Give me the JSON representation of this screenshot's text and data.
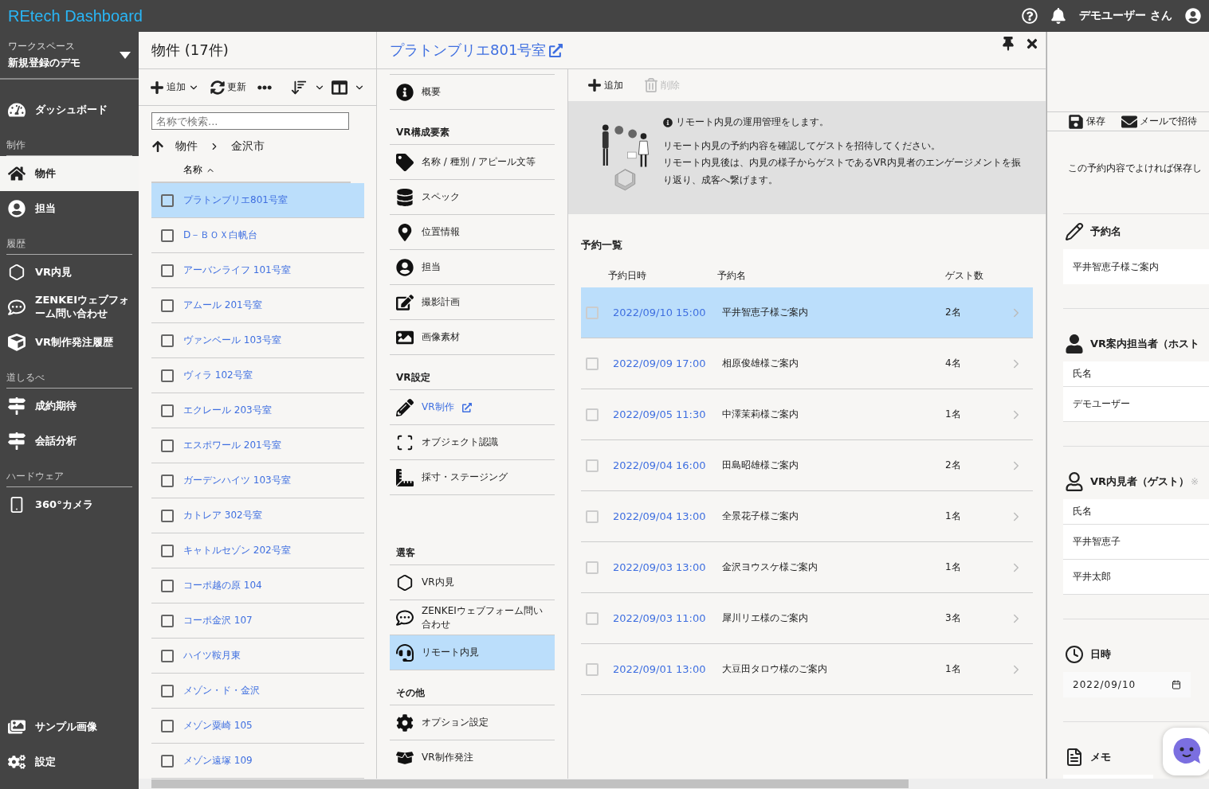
{
  "header": {
    "title": "REtech Dashboard",
    "user": "デモユーザー さん"
  },
  "sidebar": {
    "workspace_label": "ワークスペース",
    "workspace_name": "新規登録のデモ",
    "top_items": [
      {
        "label": "ダッシュボード",
        "selected": false
      }
    ],
    "sections": [
      {
        "title": "制作",
        "items": [
          {
            "label": "物件",
            "selected": true
          },
          {
            "label": "担当",
            "selected": false
          }
        ]
      },
      {
        "title": "履歴",
        "items": [
          {
            "label": "VR内見",
            "selected": false
          },
          {
            "label": "ZENKEIウェブフォーム問い合わせ",
            "selected": false
          },
          {
            "label": "VR制作発注履歴",
            "selected": false
          }
        ]
      },
      {
        "title": "道しるべ",
        "items": [
          {
            "label": "成約期待",
            "selected": false
          },
          {
            "label": "会話分析",
            "selected": false
          }
        ]
      },
      {
        "title": "ハードウェア",
        "items": [
          {
            "label": "360°カメラ",
            "selected": false
          }
        ]
      }
    ],
    "bottom_items": [
      {
        "label": "サンプル画像",
        "selected": false
      },
      {
        "label": "設定",
        "selected": false
      }
    ]
  },
  "properties": {
    "title": "物件 (17件)",
    "toolbar": [
      "追加",
      "更新"
    ],
    "search": {
      "placeholder": "名称で検索..."
    },
    "breadcrumb": [
      "物件",
      "金沢市"
    ],
    "sort_column": "名称",
    "items": [
      {
        "name": "プラトンブリエ801号室",
        "checked": false,
        "selected": true
      },
      {
        "name": "D－ＢＯＸ白帆台",
        "checked": false,
        "selected": false
      },
      {
        "name": "アーバンライフ 101号室",
        "checked": false,
        "selected": false
      },
      {
        "name": "アムール 201号室",
        "checked": false,
        "selected": false
      },
      {
        "name": "ヴァンベール 103号室",
        "checked": false,
        "selected": false
      },
      {
        "name": "ヴィラ 102号室",
        "checked": false,
        "selected": false
      },
      {
        "name": "エクレール 203号室",
        "checked": false,
        "selected": false
      },
      {
        "name": "エスポワール 201号室",
        "checked": false,
        "selected": false
      },
      {
        "name": "ガーデンハイツ 103号室",
        "checked": false,
        "selected": false
      },
      {
        "name": "カトレア 302号室",
        "checked": false,
        "selected": false
      },
      {
        "name": "キャトルセゾン 202号室",
        "checked": false,
        "selected": false
      },
      {
        "name": "コーポ越の原 104",
        "checked": false,
        "selected": false
      },
      {
        "name": "コーポ金沢 107",
        "checked": false,
        "selected": false
      },
      {
        "name": "ハイツ鞍月東",
        "checked": false,
        "selected": false
      },
      {
        "name": "メゾン・ド・金沢",
        "checked": false,
        "selected": false
      },
      {
        "name": "メゾン粟崎 105",
        "checked": false,
        "selected": false
      },
      {
        "name": "メゾン遠塚 109",
        "checked": false,
        "selected": false
      }
    ]
  },
  "detail": {
    "title": "プラトンブリエ801号室",
    "nav": [
      {
        "items": [
          {
            "label": "概要",
            "kind": "item",
            "selected": false
          }
        ]
      },
      {
        "title": "VR構成要素",
        "items": [
          {
            "label": "名称 / 種別 / アピール文等",
            "kind": "item",
            "selected": false
          },
          {
            "label": "スペック",
            "kind": "item",
            "selected": false
          },
          {
            "label": "位置情報",
            "kind": "item",
            "selected": false
          },
          {
            "label": "担当",
            "kind": "item",
            "selected": false
          },
          {
            "label": "撮影計画",
            "kind": "item",
            "selected": false
          },
          {
            "label": "画像素材",
            "kind": "item",
            "selected": false
          }
        ]
      },
      {
        "title": "VR設定",
        "items": [
          {
            "label": "VR制作",
            "kind": "link",
            "selected": false
          },
          {
            "label": "オブジェクト認識",
            "kind": "item",
            "selected": false
          },
          {
            "label": "採寸・ステージング",
            "kind": "item",
            "selected": false
          }
        ]
      },
      {
        "title": "選客",
        "items": [
          {
            "label": "VR内見",
            "kind": "item",
            "selected": false
          },
          {
            "label": "ZENKEIウェブフォーム問い合わせ",
            "kind": "item",
            "selected": false
          },
          {
            "label": "リモート内見",
            "kind": "item",
            "selected": true
          }
        ]
      },
      {
        "title": "その他",
        "items": [
          {
            "label": "オプション設定",
            "kind": "item",
            "selected": false
          },
          {
            "label": "VR制作発注",
            "kind": "item",
            "selected": false
          }
        ]
      }
    ]
  },
  "main": {
    "toolbar": [
      {
        "label": "追加",
        "disabled": false
      },
      {
        "label": "削除",
        "disabled": true
      }
    ],
    "info": {
      "heading": "リモート内見の運用管理をします。",
      "paragraphs": [
        "リモート内見の予約内容を確認してゲストを招待してください。",
        "リモート内見後は、内見の様子からゲストであるVR内見者のエンゲージメントを振り返り、成客へ繋げます。"
      ]
    },
    "reservations": {
      "title": "予約一覧",
      "columns": [
        "予約日時",
        "予約名",
        "ゲスト数"
      ],
      "rows": [
        {
          "datetime": "2022/09/10 15:00",
          "name": "平井智恵子様ご案内",
          "guests": "2名",
          "checked": false,
          "selected": true
        },
        {
          "datetime": "2022/09/09 17:00",
          "name": "相原俊雄様ご案内",
          "guests": "4名",
          "checked": false,
          "selected": false
        },
        {
          "datetime": "2022/09/05 11:30",
          "name": "中澤茉莉様ご案内",
          "guests": "1名",
          "checked": false,
          "selected": false
        },
        {
          "datetime": "2022/09/04 16:00",
          "name": "田島昭雄様ご案内",
          "guests": "2名",
          "checked": false,
          "selected": false
        },
        {
          "datetime": "2022/09/04 13:00",
          "name": "全景花子様ご案内",
          "guests": "1名",
          "checked": false,
          "selected": false
        },
        {
          "datetime": "2022/09/03 13:00",
          "name": "金沢ヨウスケ様ご案内",
          "guests": "1名",
          "checked": false,
          "selected": false
        },
        {
          "datetime": "2022/09/03 11:00",
          "name": "犀川リエ様のご案内",
          "guests": "3名",
          "checked": false,
          "selected": false
        },
        {
          "datetime": "2022/09/01 13:00",
          "name": "大豆田タロウ様のご案内",
          "guests": "1名",
          "checked": false,
          "selected": false
        }
      ]
    }
  },
  "editor": {
    "toolbar": [
      "保存",
      "メールで招待"
    ],
    "notice": "この予約内容でよければ保存し",
    "sections": [
      {
        "kind": "text",
        "title": "予約名",
        "value": "平井智恵子様ご案内"
      },
      {
        "kind": "table",
        "title": "VR案内担当者（ホスト",
        "column": "氏名",
        "rows": [
          "デモユーザー"
        ]
      },
      {
        "kind": "table",
        "title": "VR内見者（ゲスト）",
        "note": "※",
        "column": "氏名",
        "rows": [
          "平井智恵子",
          "平井太郎"
        ]
      },
      {
        "kind": "date",
        "title": "日時",
        "value": "2022/09/10"
      },
      {
        "kind": "memo",
        "title": "メモ"
      }
    ]
  }
}
